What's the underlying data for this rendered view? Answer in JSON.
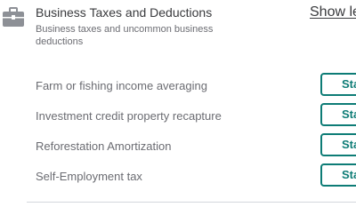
{
  "section": {
    "icon": "briefcase-icon",
    "title": "Business Taxes and Deductions",
    "description": "Business taxes and uncommon business deductions",
    "show_less_label": "Show le"
  },
  "rows": [
    {
      "label": "Farm or fishing income averaging",
      "button_label": "Sta"
    },
    {
      "label": "Investment credit property recapture",
      "button_label": "Sta"
    },
    {
      "label": "Reforestation Amortization",
      "button_label": "Sta"
    },
    {
      "label": "Self-Employment tax",
      "button_label": "Sta"
    }
  ],
  "colors": {
    "accent": "#0d7c76",
    "icon_gray": "#8d9096",
    "text": "#393a3d",
    "muted_text": "#6b6c72"
  }
}
